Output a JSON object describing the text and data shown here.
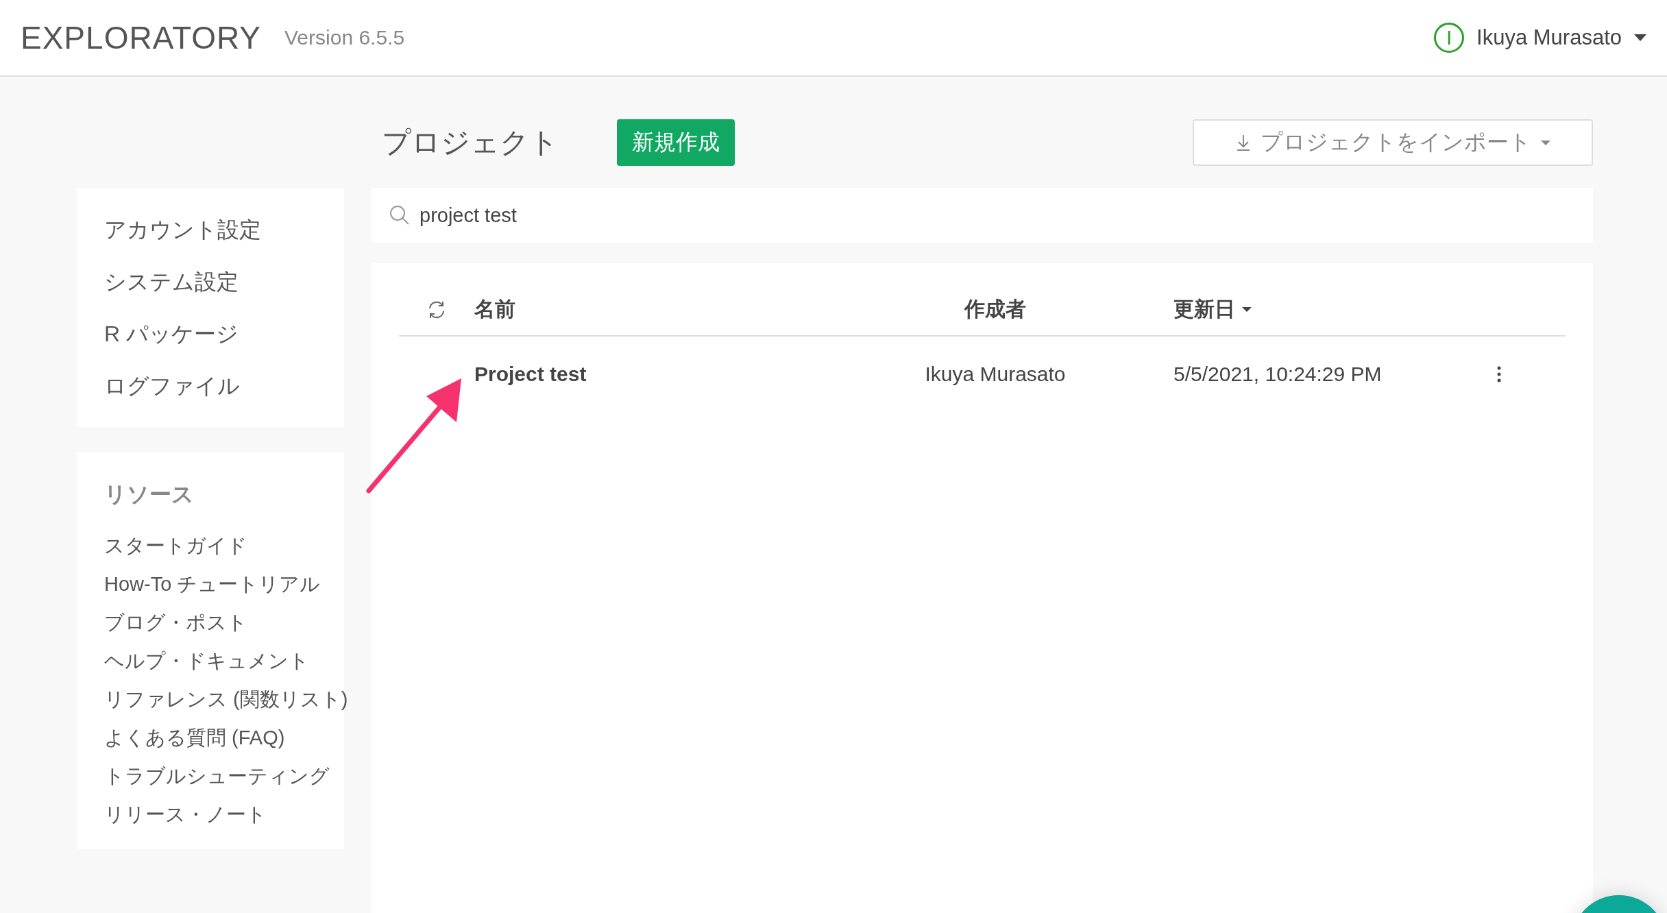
{
  "header": {
    "logo": "EXPLORATORY",
    "version": "Version 6.5.5",
    "user": {
      "initial": "I",
      "name": "Ikuya Murasato"
    }
  },
  "sidebar": {
    "settings": [
      "アカウント設定",
      "システム設定",
      "R パッケージ",
      "ログファイル"
    ],
    "resources": {
      "title": "リソース",
      "items": [
        "スタートガイド",
        "How-To チュートリアル",
        "ブログ・ポスト",
        "ヘルプ・ドキュメント",
        "リファレンス (関数リスト)",
        "よくある質問 (FAQ)",
        "トラブルシューティング",
        "リリース・ノート"
      ]
    }
  },
  "main": {
    "title": "プロジェクト",
    "new_button": "新規作成",
    "import_button": "プロジェクトをインポート",
    "search": {
      "value": "project test"
    },
    "table": {
      "columns": [
        {
          "label": "名前",
          "sorted": false
        },
        {
          "label": "作成者",
          "sorted": false
        },
        {
          "label": "更新日",
          "sorted": true
        }
      ],
      "rows": [
        {
          "name": "Project test",
          "author": "Ikuya Murasato",
          "updated": "5/5/2021, 10:24:29 PM"
        }
      ]
    }
  }
}
